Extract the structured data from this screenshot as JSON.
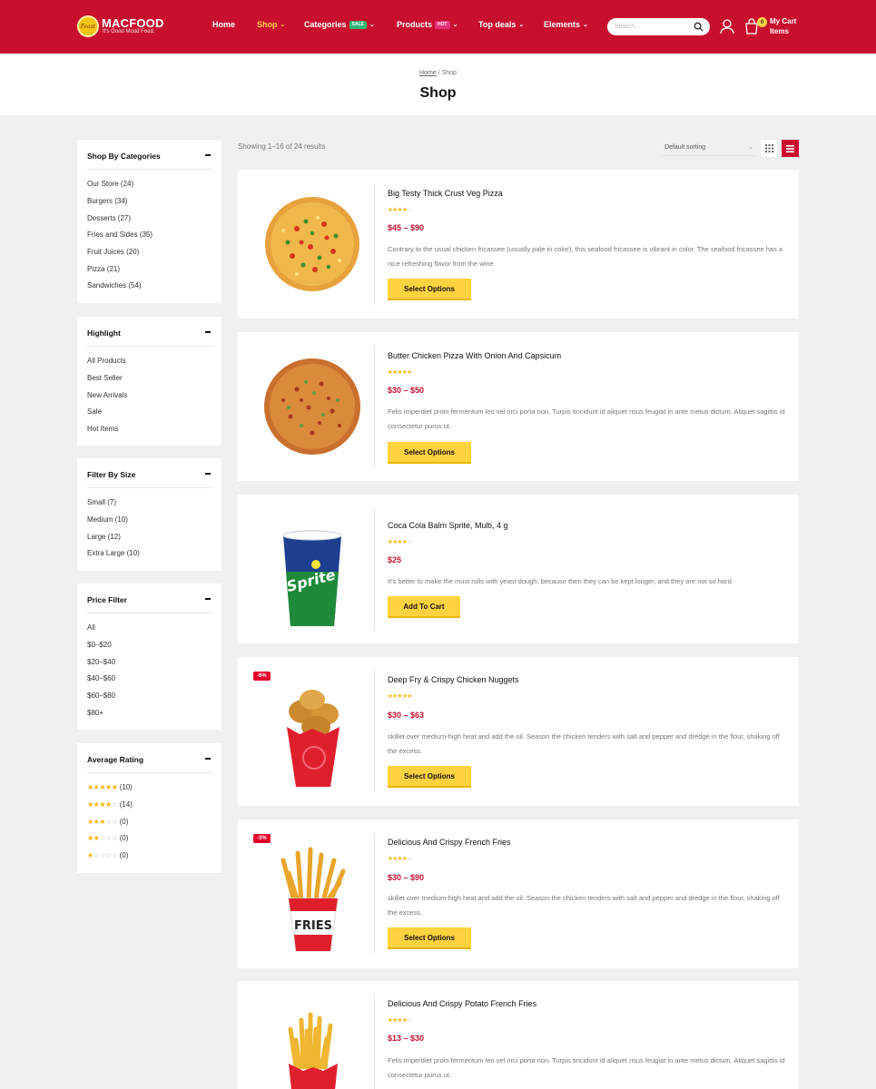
{
  "header": {
    "logo_name": "MACFOOD",
    "logo_tagline": "It's Good Mood Food.",
    "logo_script": "Feast",
    "nav": [
      {
        "label": "Home"
      },
      {
        "label": "Shop"
      },
      {
        "label": "Categories",
        "badge": "SALE"
      },
      {
        "label": "Products",
        "badge": "HOT"
      },
      {
        "label": "Top deals"
      },
      {
        "label": "Elements"
      }
    ],
    "search_placeholder": "Search...",
    "cart_count": "0",
    "cart_title": "My Cart",
    "cart_sub": "Items",
    "colors": {
      "brand": "#c8102e",
      "accent": "#ffd23f",
      "sale_badge": "#2bb673",
      "hot_badge": "#e4317f"
    }
  },
  "page": {
    "breadcrumb_home": "Home",
    "breadcrumb_sep": " / ",
    "breadcrumb_current": "Shop",
    "title": "Shop"
  },
  "sidebar": {
    "categories": {
      "title": "Shop By Categories",
      "items": [
        "Our Store (24)",
        "Burgers (34)",
        "Desserts (27)",
        "Fries and Sides (35)",
        "Fruit Juices (20)",
        "Pizza (21)",
        "Sandwiches (54)"
      ]
    },
    "highlight": {
      "title": "Highlight",
      "items": [
        "All Products",
        "Best Seller",
        "New Arrivals",
        "Sale",
        "Hot Items"
      ]
    },
    "size": {
      "title": "Filter By Size",
      "items": [
        "Small (7)",
        "Medium (10)",
        "Large (12)",
        "Extra Large (10)"
      ]
    },
    "price": {
      "title": "Price Filter",
      "items": [
        "All",
        "$0–$20",
        "$20–$40",
        "$40–$60",
        "$60–$80",
        "$80+"
      ]
    },
    "rating": {
      "title": "Average Rating",
      "items": [
        {
          "stars": 5,
          "count": "(10)"
        },
        {
          "stars": 4,
          "count": "(14)"
        },
        {
          "stars": 3,
          "count": "(0)"
        },
        {
          "stars": 2,
          "count": "(0)"
        },
        {
          "stars": 1,
          "count": "(0)"
        }
      ]
    }
  },
  "toolbar": {
    "results": "Showing 1–16 of 24 results",
    "sort_selected": "Default sorting",
    "view_grid_icon": "grid-icon",
    "view_list_icon": "list-icon"
  },
  "products": [
    {
      "name": "Big Testy Thick Crust Veg Pizza",
      "rating": 4,
      "price": "$45 – $90",
      "description": "Contrary to the usual chicken fricassee (usually pale in color), this seafood fricassee is vibrant in color. The seafood fricassee has a nice refreshing flavor from the wine.",
      "button": "Select Options",
      "sale": "",
      "image": "pizza-veg"
    },
    {
      "name": "Butter Chicken Pizza With Onion And Capsicum",
      "rating": 5,
      "price": "$30 – $50",
      "description": "Felis imperdiet proin fermentum leo vel orci porta non. Turpis tincidunt id aliquet risus feugiat in ante metus dictum. Aliquet sagittis id consectetur purus ut.",
      "button": "Select Options",
      "sale": "",
      "image": "pizza-chicken"
    },
    {
      "name": "Coca Cola Balm Sprite, Multi, 4 g",
      "rating": 4,
      "price": "$25",
      "description": "It's better to make the must rolls with yeast dough, because then they can be kept longer, and they are not so hard.",
      "button": "Add To Cart",
      "sale": "",
      "image": "sprite-cup"
    },
    {
      "name": "Deep Fry & Crispy Chicken Nuggets",
      "rating": 5,
      "price": "$30 – $63",
      "description": "skillet over medium-high heat and add the oil. Season the chicken tenders with salt and pepper and dredge in the flour, shaking off the excess.",
      "button": "Select Options",
      "sale": "-6%",
      "image": "nuggets"
    },
    {
      "name": "Delicious And Crispy French Fries",
      "rating": 4,
      "price": "$30 – $90",
      "description": "skillet over medium-high heat and add the oil. Season the chicken tenders with salt and pepper and dredge in the flour, shaking off the excess.",
      "button": "Select Options",
      "sale": "-3%",
      "image": "fries-bucket",
      "image_text": "FRIES"
    },
    {
      "name": "Delicious And Crispy Potato French Fries",
      "rating": 4,
      "price": "$13 – $30",
      "description": "Felis imperdiet proin fermentum leo vel orci porta non. Turpis tincidunt id aliquet risus feugiat in ante metus dictum. Aliquet sagittis id consectetur purus ut.",
      "button": "Select Options",
      "sale": "",
      "image": "fries-box"
    }
  ]
}
